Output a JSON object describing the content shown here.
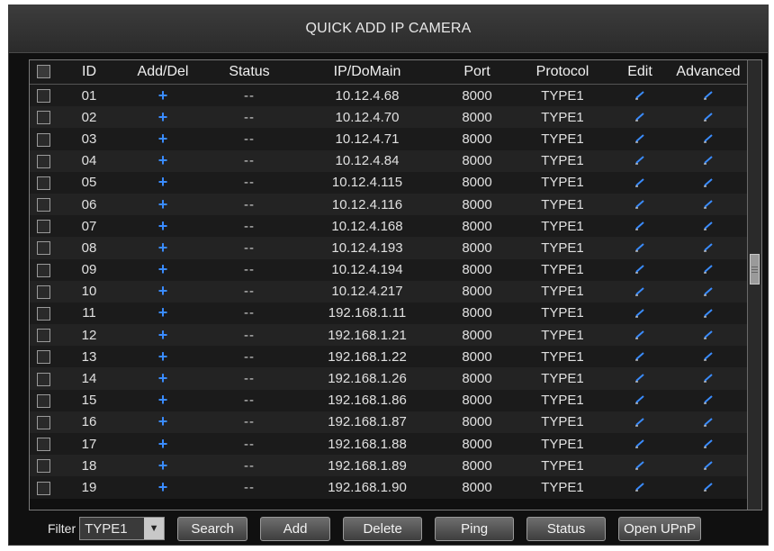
{
  "window": {
    "title": "QUICK ADD IP CAMERA"
  },
  "table": {
    "headers": {
      "id": "ID",
      "add_del": "Add/Del",
      "status": "Status",
      "ip_domain": "IP/DoMain",
      "port": "Port",
      "protocol": "Protocol",
      "edit": "Edit",
      "advanced": "Advanced"
    },
    "rows": [
      {
        "id": "01",
        "status": "--",
        "ip": "10.12.4.68",
        "port": "8000",
        "protocol": "TYPE1"
      },
      {
        "id": "02",
        "status": "--",
        "ip": "10.12.4.70",
        "port": "8000",
        "protocol": "TYPE1"
      },
      {
        "id": "03",
        "status": "--",
        "ip": "10.12.4.71",
        "port": "8000",
        "protocol": "TYPE1"
      },
      {
        "id": "04",
        "status": "--",
        "ip": "10.12.4.84",
        "port": "8000",
        "protocol": "TYPE1"
      },
      {
        "id": "05",
        "status": "--",
        "ip": "10.12.4.115",
        "port": "8000",
        "protocol": "TYPE1"
      },
      {
        "id": "06",
        "status": "--",
        "ip": "10.12.4.116",
        "port": "8000",
        "protocol": "TYPE1"
      },
      {
        "id": "07",
        "status": "--",
        "ip": "10.12.4.168",
        "port": "8000",
        "protocol": "TYPE1"
      },
      {
        "id": "08",
        "status": "--",
        "ip": "10.12.4.193",
        "port": "8000",
        "protocol": "TYPE1"
      },
      {
        "id": "09",
        "status": "--",
        "ip": "10.12.4.194",
        "port": "8000",
        "protocol": "TYPE1"
      },
      {
        "id": "10",
        "status": "--",
        "ip": "10.12.4.217",
        "port": "8000",
        "protocol": "TYPE1"
      },
      {
        "id": "11",
        "status": "--",
        "ip": "192.168.1.11",
        "port": "8000",
        "protocol": "TYPE1"
      },
      {
        "id": "12",
        "status": "--",
        "ip": "192.168.1.21",
        "port": "8000",
        "protocol": "TYPE1"
      },
      {
        "id": "13",
        "status": "--",
        "ip": "192.168.1.22",
        "port": "8000",
        "protocol": "TYPE1"
      },
      {
        "id": "14",
        "status": "--",
        "ip": "192.168.1.26",
        "port": "8000",
        "protocol": "TYPE1"
      },
      {
        "id": "15",
        "status": "--",
        "ip": "192.168.1.86",
        "port": "8000",
        "protocol": "TYPE1"
      },
      {
        "id": "16",
        "status": "--",
        "ip": "192.168.1.87",
        "port": "8000",
        "protocol": "TYPE1"
      },
      {
        "id": "17",
        "status": "--",
        "ip": "192.168.1.88",
        "port": "8000",
        "protocol": "TYPE1"
      },
      {
        "id": "18",
        "status": "--",
        "ip": "192.168.1.89",
        "port": "8000",
        "protocol": "TYPE1"
      },
      {
        "id": "19",
        "status": "--",
        "ip": "192.168.1.90",
        "port": "8000",
        "protocol": "TYPE1"
      }
    ],
    "add_icon": "plus-icon",
    "edit_icon": "pencil-icon",
    "accent_color": "#3a8cff"
  },
  "filter": {
    "label": "Filter",
    "selected": "TYPE1"
  },
  "buttons": {
    "search": "Search",
    "add": "Add",
    "delete": "Delete",
    "ping": "Ping",
    "status": "Status",
    "open_upnp": "Open UPnP"
  }
}
